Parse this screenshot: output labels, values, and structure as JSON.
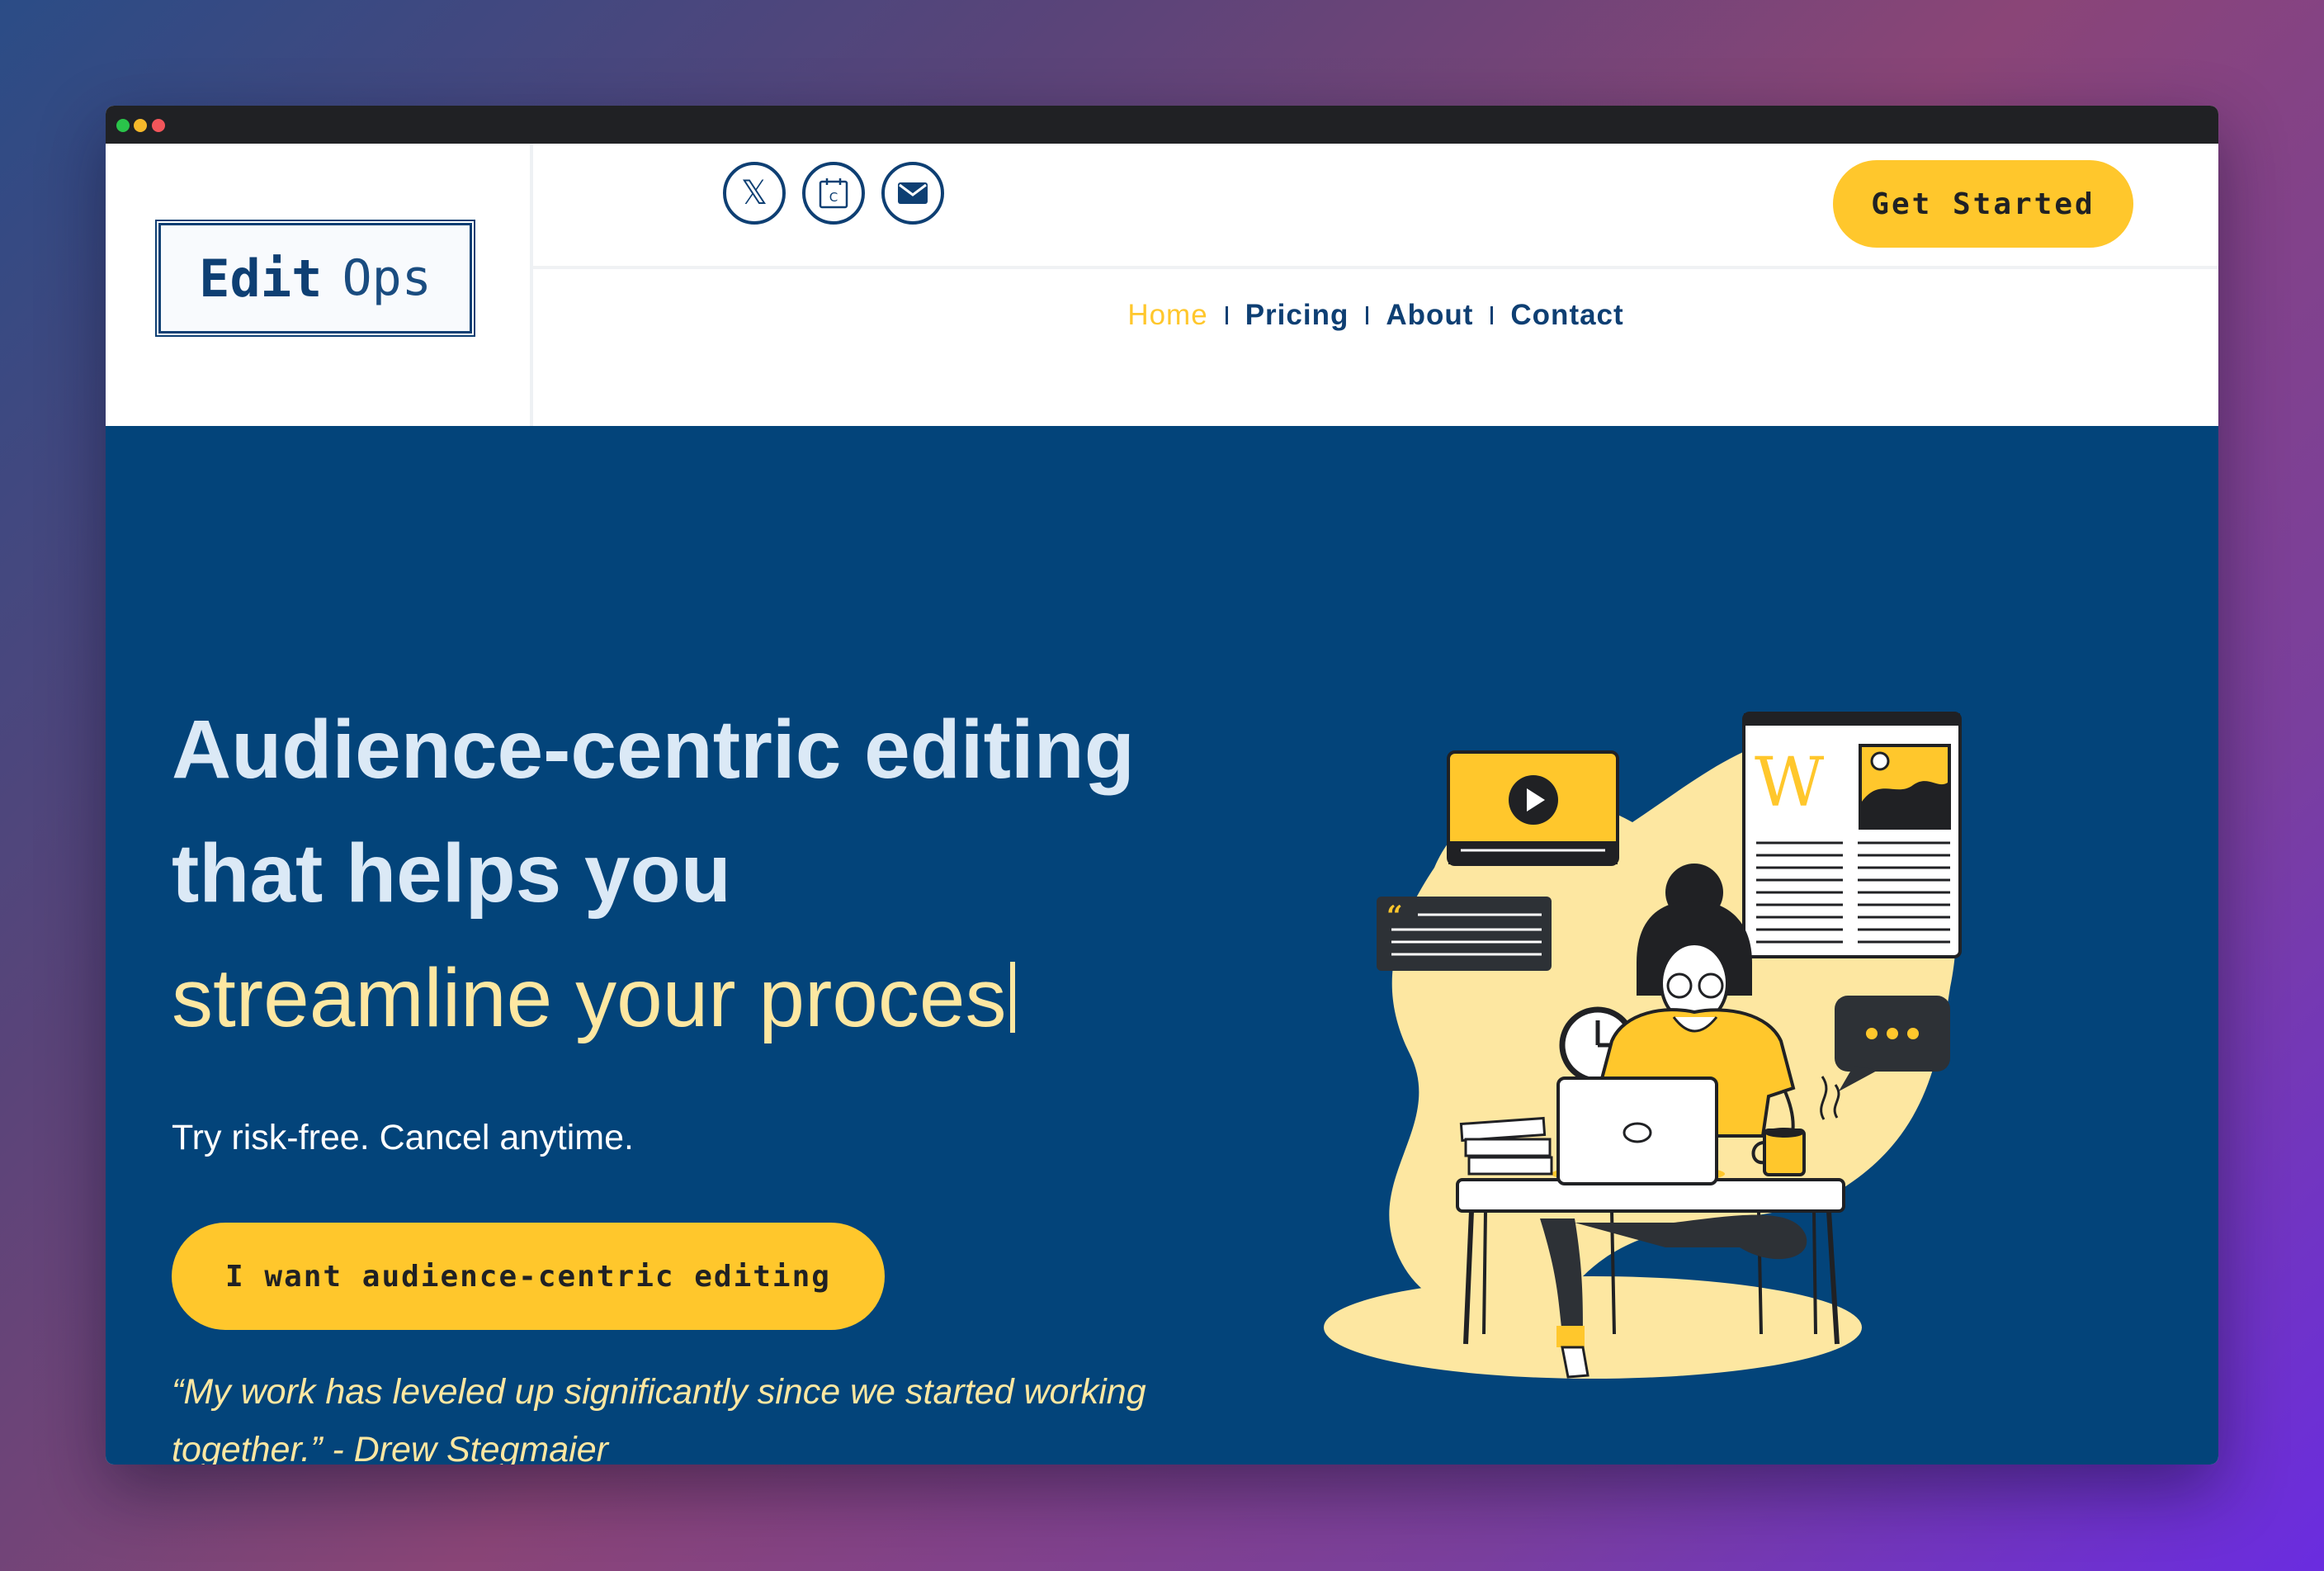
{
  "window": {
    "traffic_lights": [
      "#2ac44a",
      "#f5b82a",
      "#f2555a"
    ]
  },
  "brand": {
    "logo_bold": "Edit",
    "logo_light": "Ops",
    "primary": "#0e3f73",
    "accent": "#ffc72c",
    "hero_bg": "#03447a"
  },
  "header": {
    "social": [
      {
        "name": "x-icon",
        "glyph": "𝕏"
      },
      {
        "name": "calendar-icon",
        "glyph": "C"
      },
      {
        "name": "mail-icon"
      }
    ],
    "cta_label": "Get Started"
  },
  "nav": {
    "items": [
      {
        "label": "Home",
        "active": true
      },
      {
        "label": "Pricing",
        "active": false
      },
      {
        "label": "About",
        "active": false
      },
      {
        "label": "Contact",
        "active": false
      }
    ]
  },
  "hero": {
    "headline_line1": "Audience-centric editing",
    "headline_line2": "that helps you",
    "headline_typed": "streamline your proces",
    "subtext": "Try risk-free. Cancel anytime.",
    "cta_label": "I want audience-centric editing",
    "testimonial": "“My work has leveled up significantly since we started working together.” - Drew Stegmaier",
    "illustration_glyph": "W"
  },
  "chat_widget": {
    "icon": "chat-bubble-icon"
  }
}
